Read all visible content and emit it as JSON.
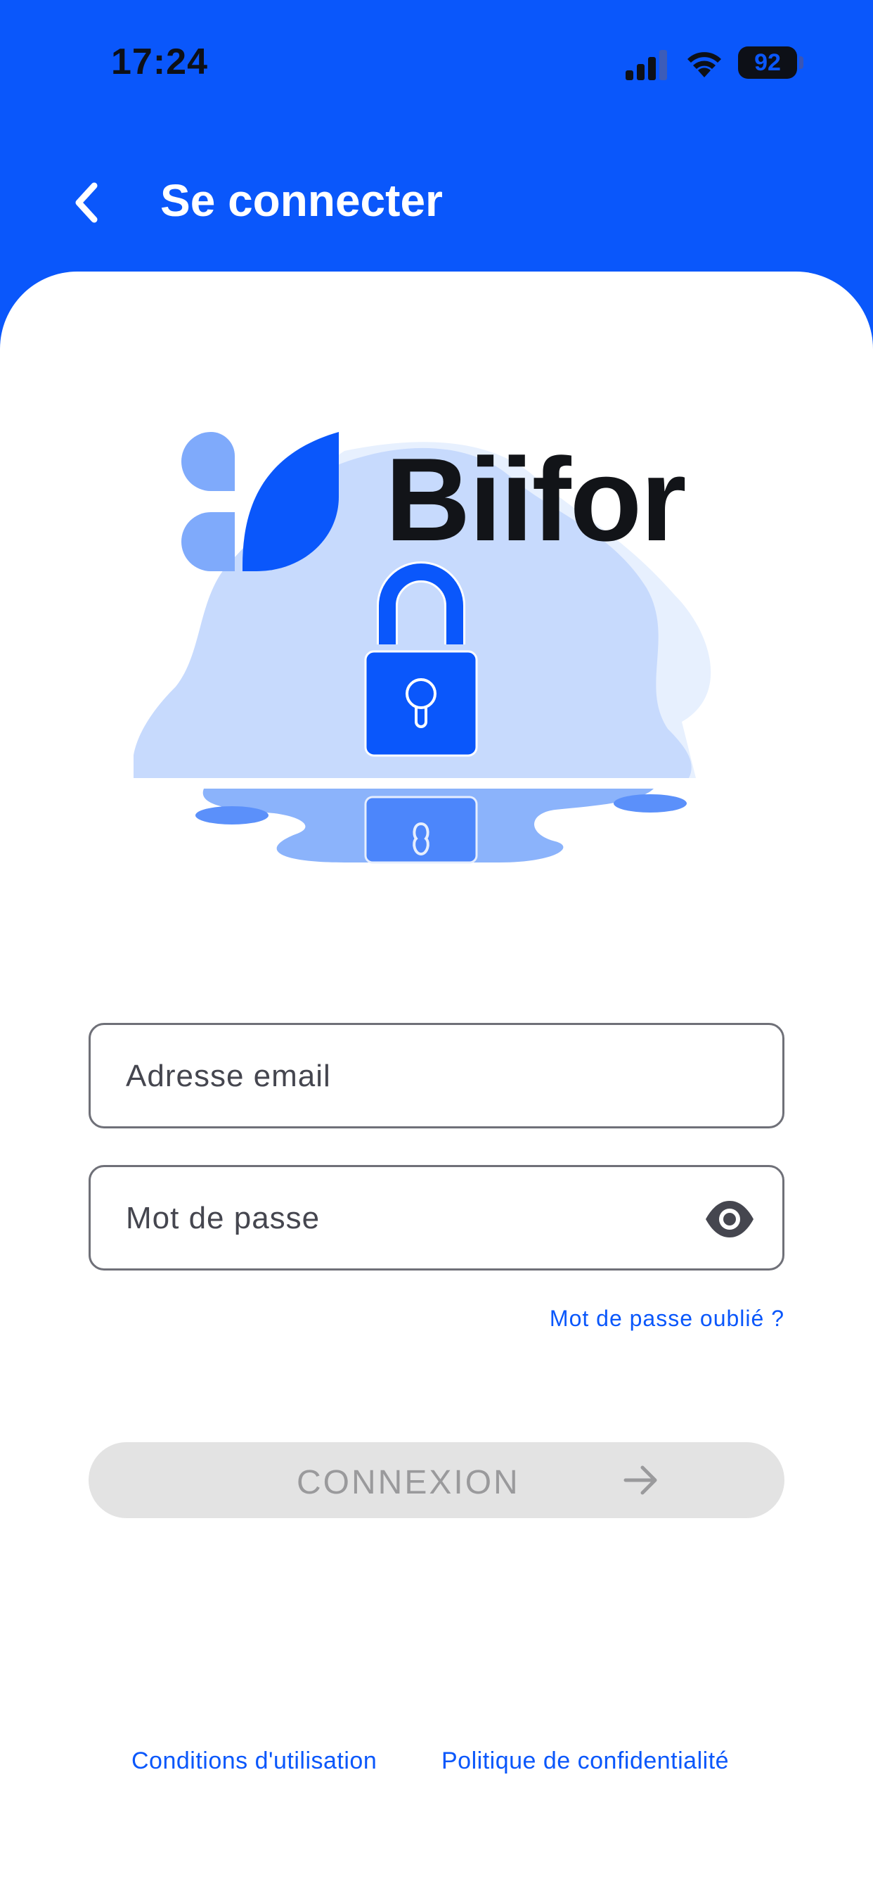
{
  "status_bar": {
    "time": "17:24",
    "battery": "92"
  },
  "header": {
    "title": "Se connecter"
  },
  "logo": {
    "brand_name": "Biifor"
  },
  "form": {
    "email_placeholder": "Adresse email",
    "password_placeholder": "Mot de passe",
    "forgot_password": "Mot de passe oublié ?",
    "submit_label": "CONNEXION"
  },
  "footer": {
    "terms": "Conditions d'utilisation",
    "privacy": "Politique de confidentialité"
  },
  "icons": [
    "back-arrow-icon",
    "signal-icon",
    "wifi-icon",
    "battery-icon",
    "lock-icon",
    "eye-icon",
    "arrow-right-icon"
  ],
  "colors": {
    "primary": "#0a57fb",
    "illustration_light": "#c7dafd",
    "disabled": "#e3e3e3"
  }
}
